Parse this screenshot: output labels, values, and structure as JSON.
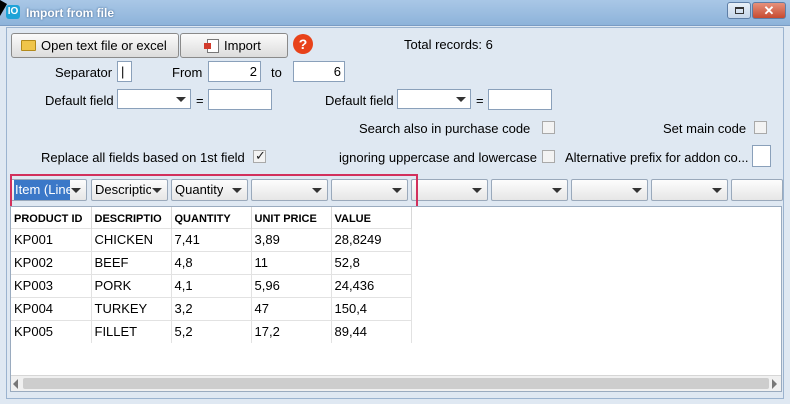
{
  "window": {
    "title": "Import from file",
    "close_glyph": "✕",
    "app_icon": "IO"
  },
  "toolbar": {
    "open_label": "Open text file or excel",
    "import_label": "Import",
    "help_glyph": "?",
    "total_label": "Total records:",
    "total_value": "6"
  },
  "form": {
    "separator_label": "Separator",
    "separator_value": "|",
    "from_label": "From",
    "from_value": "2",
    "to_label": "to",
    "to_value": "6",
    "default_field_label_1": "Default field",
    "default_field_label_2": "Default field",
    "equals": "=",
    "search_purchase_label": "Search also in purchase code",
    "set_main_code_label": "Set main code",
    "replace_fields_label": "Replace all fields based on 1st field",
    "ignore_case_label": "ignoring uppercase and lowercase",
    "alt_prefix_label": "Alternative prefix for addon co...",
    "replace_fields_checked": true
  },
  "column_selectors": [
    "Item (Line",
    "Descriptic",
    "Quantity",
    "",
    "",
    "",
    "",
    "",
    "",
    ""
  ],
  "table": {
    "headers": [
      "PRODUCT ID",
      "DESCRIPTIO",
      "QUANTITY",
      "UNIT PRICE",
      "VALUE"
    ],
    "rows": [
      [
        "KP001",
        "CHICKEN",
        "7,41",
        "3,89",
        "28,8249"
      ],
      [
        "KP002",
        "BEEF",
        "4,8",
        "11",
        "52,8"
      ],
      [
        "KP003",
        "PORK",
        "4,1",
        "5,96",
        "24,436"
      ],
      [
        "KP004",
        "TURKEY",
        "3,2",
        "47",
        "150,4"
      ],
      [
        "KP005",
        "FILLET",
        "5,2",
        "17,2",
        "89,44"
      ]
    ]
  },
  "icons": {
    "open": "folder-icon",
    "import": "document-icon",
    "help": "help-icon",
    "app": "app-icon"
  }
}
